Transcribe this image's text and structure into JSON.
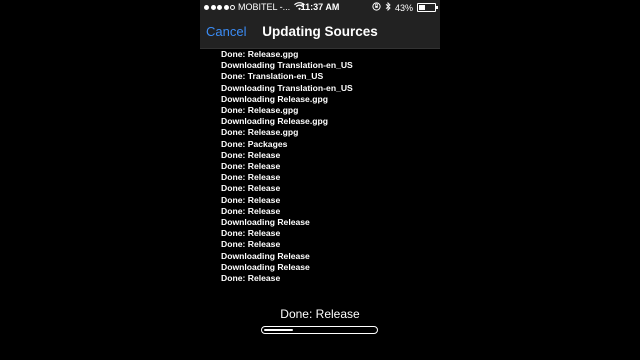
{
  "status_bar": {
    "signal_bars": 5,
    "signal_filled": 4,
    "carrier": "MOBITEL -...",
    "time": "11:37 AM",
    "battery": "43%",
    "battery_level": 0.43
  },
  "nav": {
    "cancel_label": "Cancel",
    "title": "Updating Sources"
  },
  "log": [
    "Done: Release.gpg",
    "Downloading Translation-en_US",
    "Done: Translation-en_US",
    "Downloading Translation-en_US",
    "Downloading Release.gpg",
    "Done: Release.gpg",
    "Downloading Release.gpg",
    "Done: Release.gpg",
    "Done: Packages",
    "Done: Release",
    "Done: Release",
    "Done: Release",
    "Done: Release",
    "Done: Release",
    "Done: Release",
    "Downloading Release",
    "Done: Release",
    "Done: Release",
    "Downloading Release",
    "Downloading Release",
    "Done: Release"
  ],
  "footer": {
    "current_status": "Done: Release",
    "progress": 0.26
  },
  "colors": {
    "accent": "#3b8cf5",
    "bar_background": "#222222",
    "background": "#000000"
  }
}
